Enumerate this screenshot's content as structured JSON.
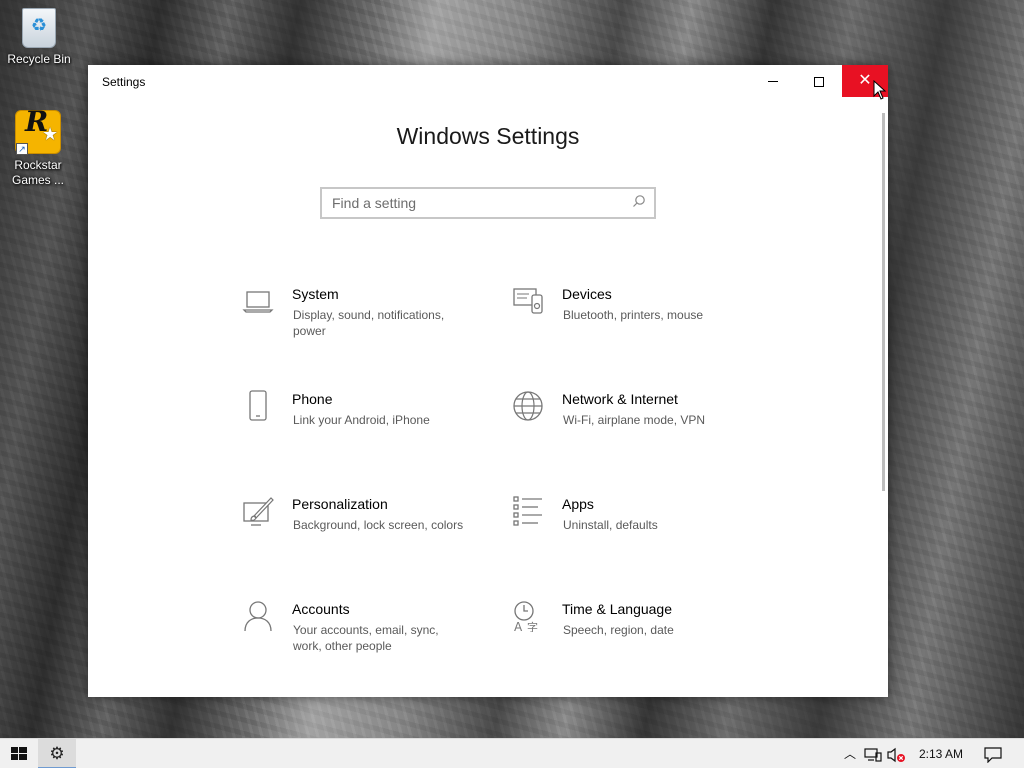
{
  "desktop": {
    "icons": [
      {
        "label": "Recycle Bin",
        "icon": "recycle-bin-icon"
      },
      {
        "label": "Rockstar Games ...",
        "icon": "rockstar-games-icon"
      }
    ]
  },
  "window": {
    "title": "Settings",
    "heading": "Windows Settings",
    "search": {
      "placeholder": "Find a setting",
      "icon": "search-icon"
    },
    "categories": [
      {
        "name": "System",
        "desc": "Display, sound, notifications, power",
        "icon": "laptop-icon"
      },
      {
        "name": "Devices",
        "desc": "Bluetooth, printers, mouse",
        "icon": "devices-icon"
      },
      {
        "name": "Phone",
        "desc": "Link your Android, iPhone",
        "icon": "phone-icon"
      },
      {
        "name": "Network & Internet",
        "desc": "Wi-Fi, airplane mode, VPN",
        "icon": "globe-icon"
      },
      {
        "name": "Personalization",
        "desc": "Background, lock screen, colors",
        "icon": "paint-icon"
      },
      {
        "name": "Apps",
        "desc": "Uninstall, defaults",
        "icon": "apps-list-icon"
      },
      {
        "name": "Accounts",
        "desc": "Your accounts, email, sync, work, other people",
        "icon": "person-icon"
      },
      {
        "name": "Time & Language",
        "desc": "Speech, region, date",
        "icon": "time-language-icon"
      }
    ]
  },
  "taskbar": {
    "clock": "2:13 AM",
    "colors": {
      "close_red": "#e81123",
      "taskbar_bg": "#f0f0f0"
    }
  }
}
